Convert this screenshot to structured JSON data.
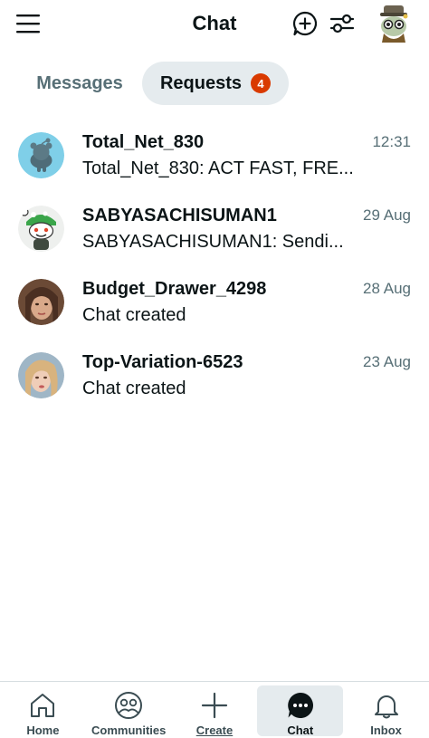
{
  "header": {
    "title": "Chat",
    "icons": {
      "menu": "menu-icon",
      "new_chat": "new-chat-plus-icon",
      "filter": "filter-sliders-icon",
      "avatar": "user-avatar"
    }
  },
  "tabs": {
    "messages_label": "Messages",
    "requests_label": "Requests",
    "requests_count": "4",
    "active": "Requests"
  },
  "chats": [
    {
      "name": "Total_Net_830",
      "preview": "Total_Net_830: ACT FAST, FRE...",
      "time": "12:31"
    },
    {
      "name": "SABYASACHISUMAN1",
      "preview": "SABYASACHISUMAN1: Sendi...",
      "time": "29 Aug"
    },
    {
      "name": "Budget_Drawer_4298",
      "preview": "Chat created",
      "time": "28 Aug"
    },
    {
      "name": "Top-Variation-6523",
      "preview": "Chat created",
      "time": "23 Aug"
    }
  ],
  "bottom_nav": {
    "items": [
      {
        "label": "Home",
        "icon": "home-icon"
      },
      {
        "label": "Communities",
        "icon": "communities-icon"
      },
      {
        "label": "Create",
        "icon": "plus-icon"
      },
      {
        "label": "Chat",
        "icon": "chat-bubble-icon"
      },
      {
        "label": "Inbox",
        "icon": "bell-icon"
      }
    ],
    "active": "Chat"
  },
  "colors": {
    "badge": "#d93a00",
    "active_tab_bg": "#e5ebee",
    "muted_text": "#576f76"
  }
}
